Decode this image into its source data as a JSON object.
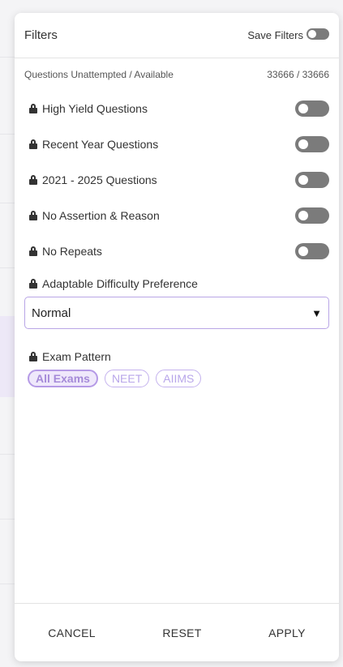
{
  "header": {
    "title": "Filters",
    "save_label": "Save Filters",
    "save_toggle_on": false
  },
  "counts": {
    "label": "Questions Unattempted / Available",
    "value": "33666 / 33666"
  },
  "toggles": [
    {
      "label": "High Yield Questions",
      "on": false,
      "locked": true
    },
    {
      "label": "Recent Year Questions",
      "on": false,
      "locked": true
    },
    {
      "label": "2021 - 2025 Questions",
      "on": false,
      "locked": true
    },
    {
      "label": "No Assertion & Reason",
      "on": false,
      "locked": true
    },
    {
      "label": "No Repeats",
      "on": false,
      "locked": true
    }
  ],
  "difficulty": {
    "label": "Adaptable Difficulty Preference",
    "selected": "Normal",
    "arrow_icon": "triangle-down-icon"
  },
  "exam_pattern": {
    "label": "Exam Pattern",
    "chips": [
      {
        "label": "All Exams",
        "active": true
      },
      {
        "label": "NEET",
        "active": false
      },
      {
        "label": "AIIMS",
        "active": false
      }
    ]
  },
  "footer": {
    "cancel": "CANCEL",
    "reset": "RESET",
    "apply": "APPLY"
  },
  "colors": {
    "accent": "#b59ae6",
    "toggle_off": "#7b7b7b"
  },
  "icons": {
    "lock": "lock-icon"
  }
}
